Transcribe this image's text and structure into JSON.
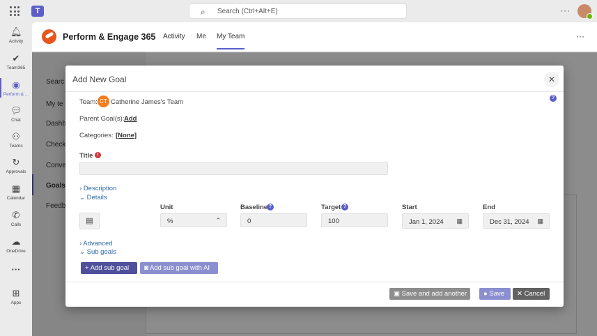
{
  "teams": {
    "search_placeholder": "Search (Ctrl+Alt+E)",
    "rail": [
      {
        "label": "Activity",
        "icon": "bell-icon"
      },
      {
        "label": "Team365",
        "icon": "check-circle-icon"
      },
      {
        "label": "Perform & ...",
        "icon": "perform-icon"
      },
      {
        "label": "Chat",
        "icon": "chat-icon"
      },
      {
        "label": "Teams",
        "icon": "teams-icon"
      },
      {
        "label": "Approvals",
        "icon": "approvals-icon"
      },
      {
        "label": "Calendar",
        "icon": "calendar-icon"
      },
      {
        "label": "Calls",
        "icon": "phone-icon"
      },
      {
        "label": "OneDrive",
        "icon": "cloud-icon"
      },
      {
        "label": "Apps",
        "icon": "plus-square-icon"
      }
    ]
  },
  "app": {
    "name": "Perform & Engage 365",
    "tabs": [
      "Activity",
      "Me",
      "My Team"
    ],
    "active_tab": "My Team",
    "nav": [
      "Searc",
      "My te",
      "Dashb",
      "Check-",
      "Conve",
      "Goals",
      "Feedb"
    ]
  },
  "modal": {
    "title": "Add New Goal",
    "team_label": "Team:",
    "team_initials": "CT",
    "team_name": "Catherine James's Team",
    "parent_label": "Parent Goal(s):",
    "parent_add": "Add",
    "categories_label": "Categories:",
    "categories_value": "[None]",
    "title_label": "Title",
    "title_value": "",
    "description_toggle": "Description",
    "details_toggle": "Details",
    "columns": {
      "unit": "Unit",
      "baseline": "Baseline",
      "target": "Target",
      "start": "Start",
      "end": "End"
    },
    "values": {
      "unit": "%",
      "baseline": "0",
      "target": "100",
      "start": "Jan 1, 2024",
      "end": "Dec 31, 2024"
    },
    "advanced_toggle": "Advanced",
    "subgoals_toggle": "Sub goals",
    "add_sub_goal": "Add sub goal",
    "add_sub_goal_ai": "Add sub goal with AI",
    "save_and_add": "Save and add another",
    "save": "Save",
    "cancel": "Cancel"
  },
  "colors": {
    "accent": "#5b5fc7",
    "brand": "#e8551e",
    "primary_button": "#4f4f9c"
  }
}
